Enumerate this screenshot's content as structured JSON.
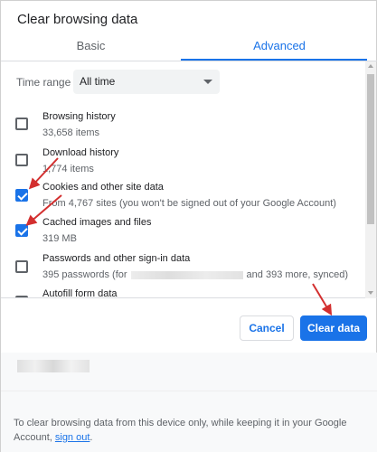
{
  "dialog": {
    "title": "Clear browsing data"
  },
  "tabs": [
    {
      "label": "Basic"
    },
    {
      "label": "Advanced"
    }
  ],
  "time_range": {
    "label": "Time range",
    "value": "All time"
  },
  "options": [
    {
      "title": "Browsing history",
      "subtitle": "33,658 items",
      "checked": false
    },
    {
      "title": "Download history",
      "subtitle": "1,774 items",
      "checked": false
    },
    {
      "title": "Cookies and other site data",
      "subtitle": "From 4,767 sites (you won't be signed out of your Google Account)",
      "checked": true
    },
    {
      "title": "Cached images and files",
      "subtitle": "319 MB",
      "checked": true
    },
    {
      "title": "Passwords and other sign-in data",
      "subtitle_prefix": "395 passwords (for",
      "subtitle_suffix": "and 393 more, synced)",
      "checked": false
    },
    {
      "title": "Autofill form data",
      "subtitle": "",
      "checked": false
    }
  ],
  "buttons": {
    "cancel": "Cancel",
    "clear": "Clear data"
  },
  "footer": {
    "text": "To clear browsing data from this device only, while keeping it in your Google Account,",
    "link": "sign out",
    "end": "."
  },
  "colors": {
    "accent": "#1a73e8",
    "annotation_arrow": "#d32f2f"
  }
}
